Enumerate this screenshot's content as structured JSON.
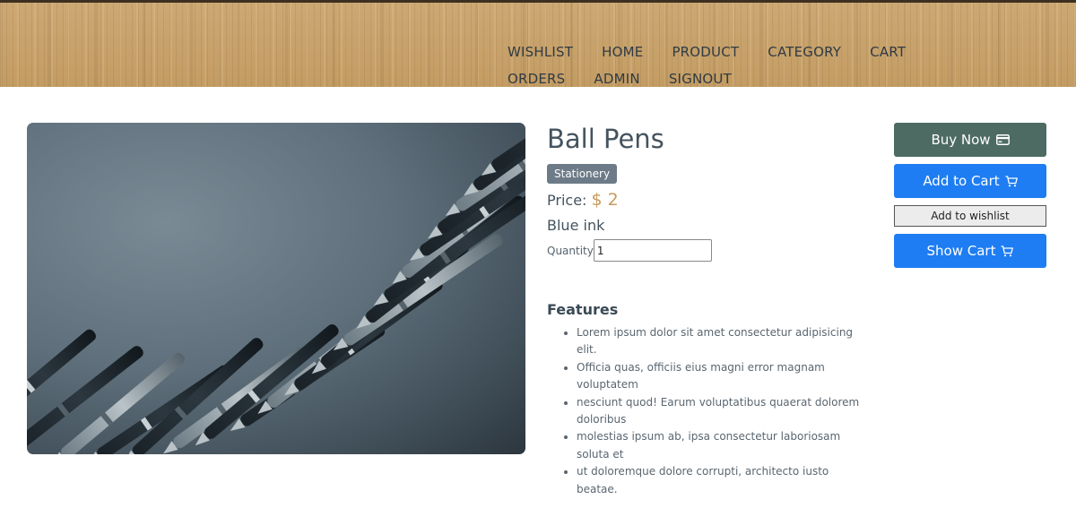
{
  "nav": {
    "items": [
      "WISHLIST",
      "HOME",
      "PRODUCT",
      "CATEGORY",
      "CART",
      "ORDERS",
      "ADMIN",
      "SIGNOUT"
    ]
  },
  "product": {
    "title": "Ball Pens",
    "category": "Stationery",
    "price_label": "Price:",
    "price_value": "$ 2",
    "description": "Blue ink",
    "quantity_label": "Quantity",
    "quantity_value": "1"
  },
  "features": {
    "title": "Features",
    "items": [
      "Lorem ipsum dolor sit amet consectetur adipisicing elit.",
      "Officia quas, officiis eius magni error magnam voluptatem",
      "nesciunt quod! Earum voluptatibus quaerat dolorem doloribus",
      "molestias ipsum ab, ipsa consectetur laboriosam soluta et",
      "ut doloremque dolore corrupti, architecto iusto beatae."
    ]
  },
  "actions": {
    "buy_now": "Buy Now",
    "add_to_cart": "Add to Cart",
    "add_to_wishlist": "Add to wishlist",
    "show_cart": "Show Cart"
  },
  "colors": {
    "header_wood": "#c9a36b",
    "buy_button": "#4d6b63",
    "primary_button": "#1e7df2",
    "price_accent": "#c79a5c",
    "badge": "#6c7b87"
  },
  "icons": {
    "buy_now": "credit-card-icon",
    "add_to_cart": "cart-icon",
    "show_cart": "cart-icon"
  }
}
